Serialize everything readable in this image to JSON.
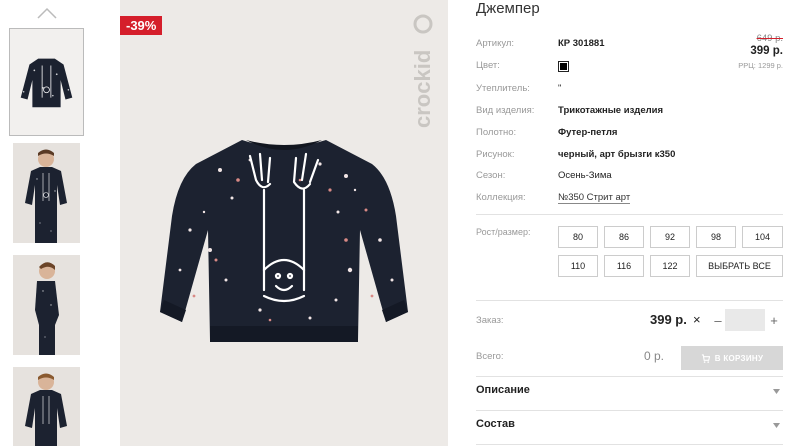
{
  "product": {
    "title": "Джемпер",
    "discount_badge": "-39%",
    "old_price": "649 р.",
    "price": "399 р.",
    "rrp": "РРЦ: 1299 р."
  },
  "attributes": [
    {
      "label": "Артикул:",
      "value": "КР 301881"
    },
    {
      "label": "Цвет:",
      "color": "#000000"
    },
    {
      "label": "Утеплитель:",
      "value": "\""
    },
    {
      "label": "Вид изделия:",
      "value": "Трикотажные изделия"
    },
    {
      "label": "Полотно:",
      "value": "Футер-петля"
    },
    {
      "label": "Рисунок:",
      "value": "черный, арт брызги к350"
    },
    {
      "label": "Сезон:",
      "value": "Осень-Зима"
    },
    {
      "label": "Коллекция:",
      "value": "№350 Стрит арт"
    }
  ],
  "sizes": {
    "label": "Рост/размер:",
    "options": [
      "80",
      "86",
      "92",
      "98",
      "104",
      "110",
      "116",
      "122"
    ],
    "select_all": "ВЫБРАТЬ ВСЕ"
  },
  "order": {
    "label": "Заказ:",
    "price": "399 р.",
    "times": "×",
    "minus": "–",
    "plus": "+",
    "quantity": ""
  },
  "total": {
    "label": "Всего:",
    "value": "0 р.",
    "button": "В КОРЗИНУ"
  },
  "accordions": [
    "Описание",
    "Состав"
  ],
  "icons": {
    "thumbs_up": "chevron-up-icon",
    "cart": "cart-icon",
    "accordion": "chevron-down-icon"
  },
  "colors": {
    "badge": "#d51e2b",
    "button_disabled": "#d7d7d7",
    "sweater": "#1c2230"
  }
}
